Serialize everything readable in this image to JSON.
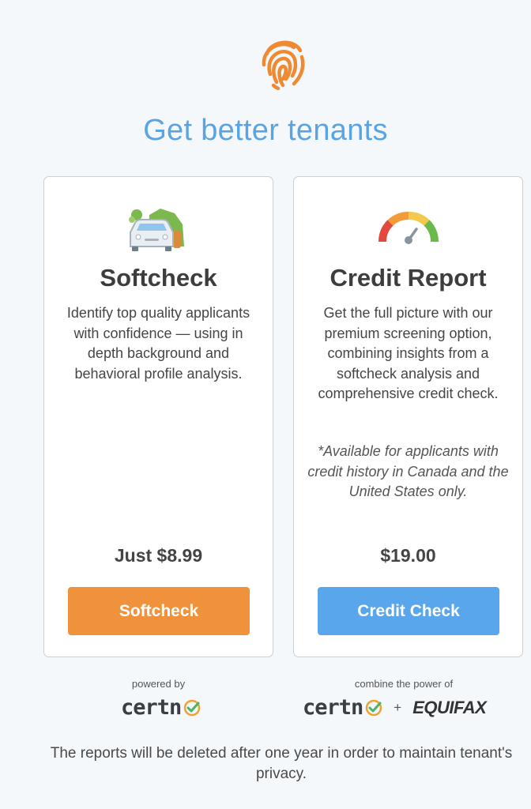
{
  "headline": "Get better tenants",
  "cards": [
    {
      "icon": "car-house-icon",
      "title": "Softcheck",
      "description": "Identify top quality applicants with confidence — using in depth background and behavioral profile analysis.",
      "price": "Just $8.99",
      "button_label": "Softcheck",
      "button_color": "#f0923c"
    },
    {
      "icon": "credit-gauge-icon",
      "title": "Credit Report",
      "description": "Get the full picture with our premium screening option, combining insights from a softcheck analysis and comprehensive credit check.",
      "note": "*Available for applicants with credit history in Canada and the United States only.",
      "price": "$19.00",
      "button_label": "Credit Check",
      "button_color": "#5aa6ec"
    }
  ],
  "powered_by": {
    "left_caption": "powered by",
    "right_caption": "combine the power of",
    "certn": "certn",
    "plus": "+",
    "equifax": "EQUIFAX"
  },
  "footer": "The reports will be deleted after one year in order to maintain tenant's privacy.",
  "colors": {
    "accent_blue": "#5aa4e4",
    "accent_orange": "#f0923c",
    "certn_check": "#4cb36a"
  }
}
